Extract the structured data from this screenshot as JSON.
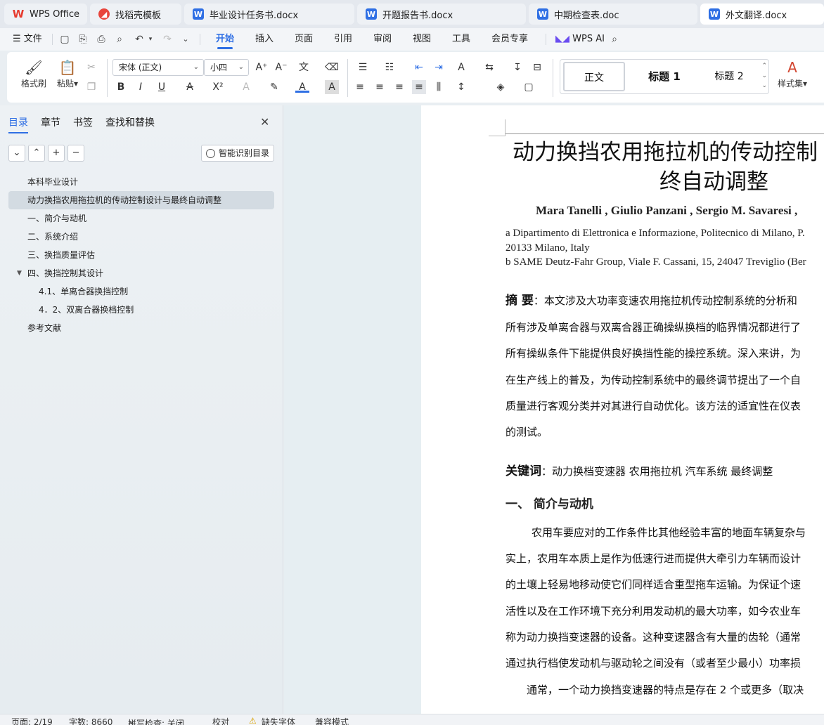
{
  "tabs": [
    {
      "label": "WPS Office",
      "icon": "wps-logo-icon"
    },
    {
      "label": "找稻壳模板",
      "icon": "docer-icon"
    },
    {
      "label": "毕业设计任务书.docx",
      "icon": "word-doc-icon"
    },
    {
      "label": "开题报告书.docx",
      "icon": "word-doc-icon"
    },
    {
      "label": "中期检查表.doc",
      "icon": "word-doc-icon"
    },
    {
      "label": "外文翻译.docx",
      "icon": "word-doc-icon"
    }
  ],
  "menu": {
    "file": "文件",
    "items": [
      "开始",
      "插入",
      "页面",
      "引用",
      "审阅",
      "视图",
      "工具",
      "会员专享"
    ],
    "active": "开始",
    "ai": "WPS AI"
  },
  "ribbon": {
    "format_painter": "格式刷",
    "paste": "粘贴",
    "font_name": "宋体 (正文)",
    "font_size": "小四",
    "styles": [
      "正文",
      "标题 1",
      "标题 2"
    ],
    "styles_set": "样式集"
  },
  "sidebar": {
    "tabs": [
      "目录",
      "章节",
      "书签",
      "查找和替换"
    ],
    "active_tab": "目录",
    "smart_button": "智能识别目录",
    "toc": [
      {
        "label": "本科毕业设计",
        "level": 1
      },
      {
        "label": "动力换挡农用拖拉机的传动控制设计与最终自动调整",
        "level": 1,
        "selected": true
      },
      {
        "label": "一、简介与动机",
        "level": 1
      },
      {
        "label": "二、系统介绍",
        "level": 1
      },
      {
        "label": "三、换挡质量评估",
        "level": 1
      },
      {
        "label": "四、换挡控制其设计",
        "level": 1,
        "expanded": true
      },
      {
        "label": "4.1、单离合器换挡控制",
        "level": 2
      },
      {
        "label": "4．2、双离合器换档控制",
        "level": 2
      },
      {
        "label": "参考文献",
        "level": 1
      }
    ]
  },
  "document": {
    "title_line1": "动力换挡农用拖拉机的传动控制",
    "title_line2": "终自动调整",
    "authors": "Mara Tanelli , Giulio Panzani , Sergio M. Savaresi ,",
    "affil_1": "a Dipartimento di Elettronica e Informazione, Politecnico di Milano, P.",
    "affil_2": "20133 Milano, Italy",
    "affil_3": "b SAME Deutz-Fahr Group, Viale F. Cassani, 15, 24047 Treviglio (Ber",
    "abstract_label": "摘  要",
    "abstract_lines": [
      "：本文涉及大功率变速农用拖拉机传动控制系统的分析和",
      "所有涉及单离合器与双离合器正确操纵换档的临界情况都进行了",
      "所有操纵条件下能提供良好换挡性能的操控系统。深入来讲，为",
      "在生产线上的普及，为传动控制系统中的最终调节提出了一个自",
      "质量进行客观分类并对其进行自动优化。该方法的适宜性在仪表",
      "的测试。"
    ],
    "keywords_label": "关键词",
    "keywords": "：动力换档变速器   农用拖拉机   汽车系统   最终调整",
    "heading_1": "一、   简介与动机",
    "body_lines": [
      "农用车要应对的工作条件比其他经验丰富的地面车辆复杂与",
      "实上，农用车本质上是作为低速行进而提供大牵引力车辆而设计",
      "的土壤上轻易地移动使它们同样适合重型拖车运输。为保证个速",
      "活性以及在工作环境下充分利用发动机的最大功率，如今农业车",
      "称为动力换挡变速器的设备。这种变速器含有大量的齿轮（通常",
      "通过执行档使发动机与驱动轮之间没有（或者至少最小）功率损",
      "通常，一个动力换挡变速器的特点是存在 2 个或更多（取决"
    ]
  },
  "status": {
    "page": "页面: 2/19",
    "words": "字数: 8660",
    "spell": "拼写检查: 关闭",
    "proof": "校对",
    "missing_font": "缺失字体",
    "compat": "兼容模式"
  },
  "colors": {
    "accent": "#2f6fe4",
    "wps_red": "#e63a2e"
  }
}
